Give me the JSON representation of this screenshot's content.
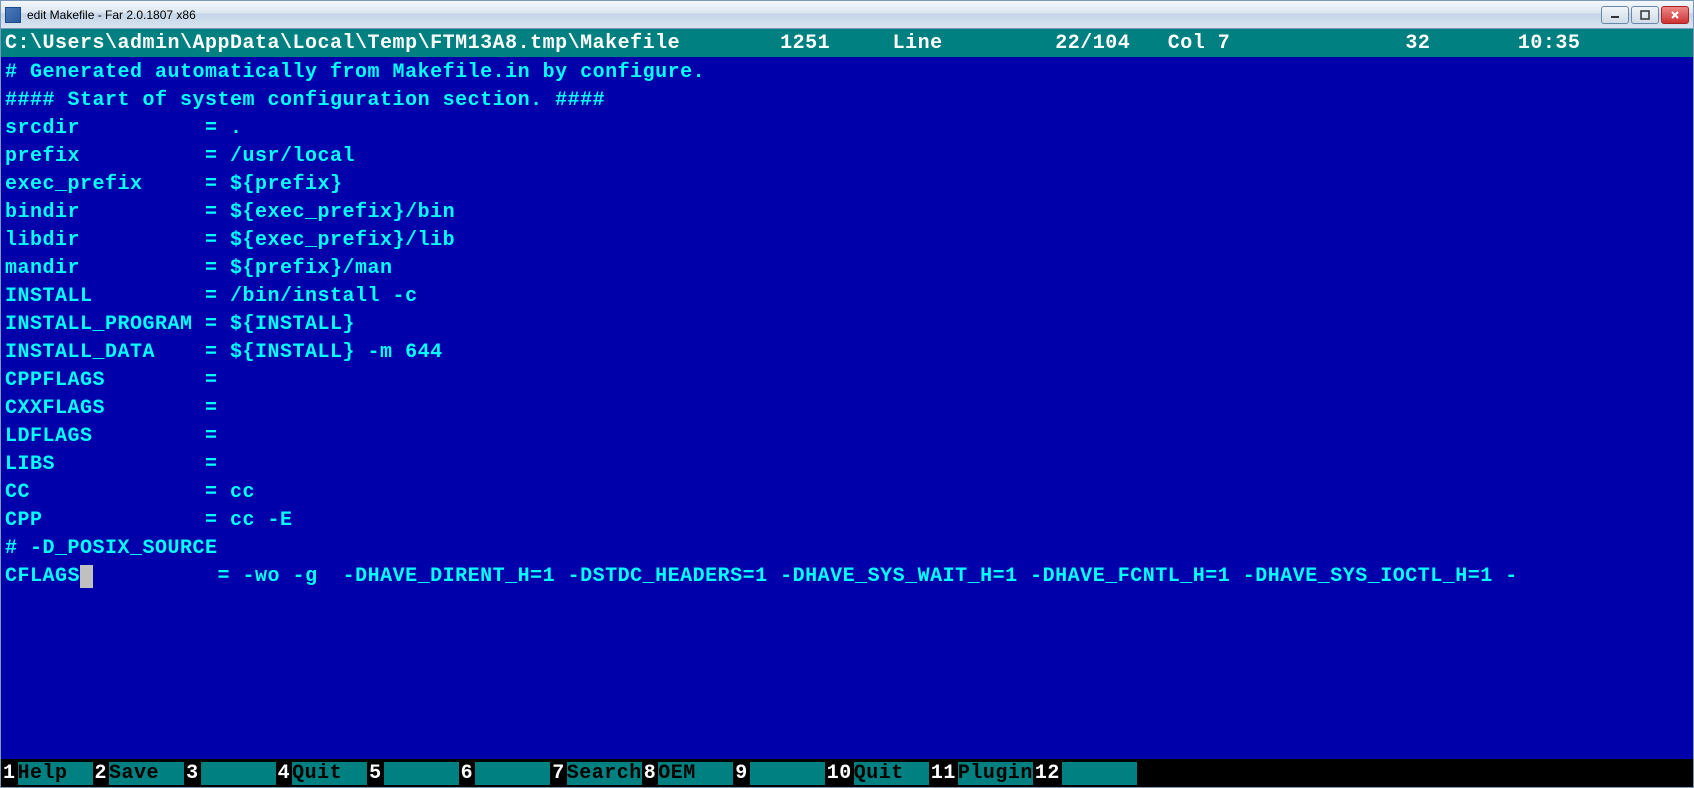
{
  "window": {
    "title": "edit Makefile - Far 2.0.1807 x86"
  },
  "status": {
    "path": "C:\\Users\\admin\\AppData\\Local\\Temp\\FTM13A8.tmp\\Makefile",
    "codepage": "1251",
    "line_label": "Line",
    "line_pos": "22/104",
    "col_label": "Col",
    "col": "7",
    "char": "32",
    "time": "10:35"
  },
  "editor": {
    "l01": "# Generated automatically from Makefile.in by configure.",
    "l02": "#### Start of system configuration section. ####",
    "l03": "",
    "l04": "srcdir          = .",
    "l05": "prefix          = /usr/local",
    "l06": "exec_prefix     = ${prefix}",
    "l07": "bindir          = ${exec_prefix}/bin",
    "l08": "libdir          = ${exec_prefix}/lib",
    "l09": "mandir          = ${prefix}/man",
    "l10": "",
    "l11": "INSTALL         = /bin/install -c",
    "l12": "INSTALL_PROGRAM = ${INSTALL}",
    "l13": "INSTALL_DATA    = ${INSTALL} -m 644",
    "l14": "CPPFLAGS        =",
    "l15": "CXXFLAGS        =",
    "l16": "LDFLAGS         =",
    "l17": "LIBS            =",
    "l18": "CC              = cc",
    "l19": "CPP             = cc -E",
    "l20": "",
    "l21": "# -D_POSIX_SOURCE",
    "l22a": "CFLAGS",
    "l22b": "          = -wo -g  -DHAVE_DIRENT_H=1 -DSTDC_HEADERS=1 -DHAVE_SYS_WAIT_H=1 -DHAVE_FCNTL_H=1 -DHAVE_SYS_IOCTL_H=1 -"
  },
  "keybar": {
    "k1n": "1",
    "k1l": "Help  ",
    "k2n": "2",
    "k2l": "Save  ",
    "k3n": "3",
    "k3l": "      ",
    "k4n": "4",
    "k4l": "Quit  ",
    "k5n": "5",
    "k5l": "      ",
    "k6n": "6",
    "k6l": "      ",
    "k7n": "7",
    "k7l": "Search",
    "k8n": "8",
    "k8l": "OEM   ",
    "k9n": "9",
    "k9l": "      ",
    "k10n": "10",
    "k10l": "Quit  ",
    "k11n": "11",
    "k11l": "Plugin",
    "k12n": "12",
    "k12l": "      "
  }
}
